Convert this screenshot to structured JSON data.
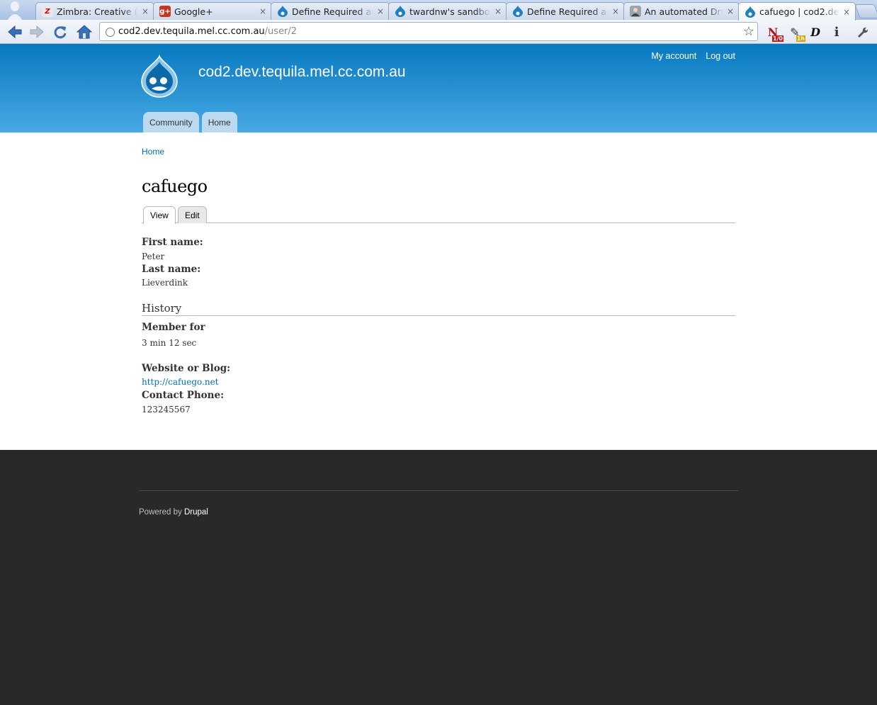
{
  "browser": {
    "tabs": [
      {
        "title": "Zimbra: Creative (",
        "icon": "zimbra-icon",
        "active": false
      },
      {
        "title": "Google+",
        "icon": "google-plus-icon",
        "active": false
      },
      {
        "title": "Define Required ar",
        "icon": "drupal-icon",
        "active": false
      },
      {
        "title": "twardnw's sandbo",
        "icon": "drupal-icon",
        "active": false
      },
      {
        "title": "Define Required ar",
        "icon": "drupal-icon",
        "active": false
      },
      {
        "title": "An automated Dru",
        "icon": "person-icon",
        "active": false
      },
      {
        "title": "cafuego | cod2.de",
        "icon": "drupal-icon",
        "active": true
      }
    ],
    "close_glyph": "×",
    "url_host": "cod2.dev.tequila.mel.cc.com.au",
    "url_path": "/user/2",
    "extensions": {
      "notifier_badge": "1/0",
      "attach_badge": "1h"
    },
    "colors": {
      "tab_active": "#ffffff",
      "toolbar": "#e8eef6"
    }
  },
  "site": {
    "name": "cod2.dev.tequila.mel.cc.com.au",
    "secondary_menu": [
      "My account",
      "Log out"
    ],
    "main_menu": [
      "Community",
      "Home"
    ],
    "colors": {
      "header_top": "#0779bf",
      "header_bottom": "#48a9e4",
      "link": "#0071b3",
      "footer": "#292929"
    }
  },
  "page": {
    "breadcrumb": "Home",
    "title": "cafuego",
    "tabs": [
      "View",
      "Edit"
    ],
    "fields": {
      "first_name_label": "First name:",
      "first_name_value": "Peter",
      "last_name_label": "Last name:",
      "last_name_value": "Lieverdink",
      "history_heading": "History",
      "member_for_label": "Member for",
      "member_for_value": "3 min 12 sec",
      "website_label": "Website or Blog:",
      "website_value": "http://cafuego.net",
      "phone_label": "Contact Phone:",
      "phone_value": "123245567"
    }
  },
  "footer": {
    "powered_prefix": "Powered by",
    "powered_link": "Drupal"
  }
}
